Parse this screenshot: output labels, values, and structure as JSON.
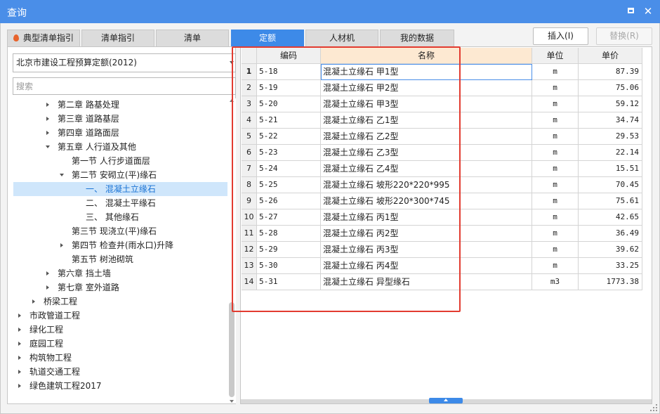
{
  "window": {
    "title": "查询",
    "maximize_icon": "maximize-icon",
    "close_icon": "close-icon",
    "close_glyph": "✕"
  },
  "tabs": [
    {
      "label": "典型清单指引",
      "icon": "fire-icon"
    },
    {
      "label": "清单指引"
    },
    {
      "label": "清单"
    },
    {
      "label": "定额",
      "active": true
    },
    {
      "label": "人材机"
    },
    {
      "label": "我的数据"
    }
  ],
  "buttons": {
    "insert": "插入(I)",
    "replace": "替换(R)"
  },
  "quota_library": {
    "selected": "北京市建设工程预算定额(2012)"
  },
  "search": {
    "placeholder": "搜索",
    "value": ""
  },
  "tree": [
    {
      "label": "第二章 路基处理",
      "expanded": false
    },
    {
      "label": "第三章 道路基层",
      "expanded": false
    },
    {
      "label": "第四章 道路面层",
      "expanded": false
    },
    {
      "label": "第五章 人行道及其他",
      "expanded": true
    },
    {
      "label": "第一节 人行步道面层"
    },
    {
      "label": "第二节 安砌立(平)缘石",
      "expanded": true
    },
    {
      "label": "一、 混凝土立缘石",
      "selected": true
    },
    {
      "label": "二、 混凝土平缘石"
    },
    {
      "label": "三、 其他缘石"
    },
    {
      "label": "第三节 现浇立(平)缘石"
    },
    {
      "label": "第四节 检查井(雨水口)升降",
      "expanded": false
    },
    {
      "label": "第五节 树池砌筑"
    },
    {
      "label": "第六章 挡土墙",
      "expanded": false
    },
    {
      "label": "第七章 室外道路",
      "expanded": false
    },
    {
      "label": "桥梁工程",
      "expanded": false
    },
    {
      "label": "市政管道工程",
      "expanded": false
    },
    {
      "label": "绿化工程",
      "expanded": false
    },
    {
      "label": "庭园工程",
      "expanded": false
    },
    {
      "label": "构筑物工程",
      "expanded": false
    },
    {
      "label": "轨道交通工程",
      "expanded": false
    },
    {
      "label": "绿色建筑工程2017",
      "expanded": false
    }
  ],
  "table": {
    "columns": {
      "code": "编码",
      "name": "名称",
      "unit": "单位",
      "price": "单价"
    },
    "rows": [
      {
        "no": "1",
        "code": "5-18",
        "name": "混凝土立缘石 甲1型",
        "unit": "m",
        "price": "87.39"
      },
      {
        "no": "2",
        "code": "5-19",
        "name": "混凝土立缘石 甲2型",
        "unit": "m",
        "price": "75.06"
      },
      {
        "no": "3",
        "code": "5-20",
        "name": "混凝土立缘石 甲3型",
        "unit": "m",
        "price": "59.12"
      },
      {
        "no": "4",
        "code": "5-21",
        "name": "混凝土立缘石 乙1型",
        "unit": "m",
        "price": "34.74"
      },
      {
        "no": "5",
        "code": "5-22",
        "name": "混凝土立缘石 乙2型",
        "unit": "m",
        "price": "29.53"
      },
      {
        "no": "6",
        "code": "5-23",
        "name": "混凝土立缘石 乙3型",
        "unit": "m",
        "price": "22.14"
      },
      {
        "no": "7",
        "code": "5-24",
        "name": "混凝土立缘石 乙4型",
        "unit": "m",
        "price": "15.51"
      },
      {
        "no": "8",
        "code": "5-25",
        "name": "混凝土立缘石 坡形220*220*995",
        "unit": "m",
        "price": "70.45"
      },
      {
        "no": "9",
        "code": "5-26",
        "name": "混凝土立缘石 坡形220*300*745",
        "unit": "m",
        "price": "75.61"
      },
      {
        "no": "10",
        "code": "5-27",
        "name": "混凝土立缘石 丙1型",
        "unit": "m",
        "price": "42.65"
      },
      {
        "no": "11",
        "code": "5-28",
        "name": "混凝土立缘石 丙2型",
        "unit": "m",
        "price": "36.49"
      },
      {
        "no": "12",
        "code": "5-29",
        "name": "混凝土立缘石 丙3型",
        "unit": "m",
        "price": "39.62"
      },
      {
        "no": "13",
        "code": "5-30",
        "name": "混凝土立缘石 丙4型",
        "unit": "m",
        "price": "33.25"
      },
      {
        "no": "14",
        "code": "5-31",
        "name": "混凝土立缘石 异型缘石",
        "unit": "m3",
        "price": "1773.38"
      }
    ]
  },
  "colors": {
    "titlebar": "#4a8ee8",
    "active_tab": "#3d8ae8",
    "highlight_box": "#e23b30",
    "selected_node_bg": "#cfe6fb",
    "name_header_bg": "#fde9d2"
  }
}
